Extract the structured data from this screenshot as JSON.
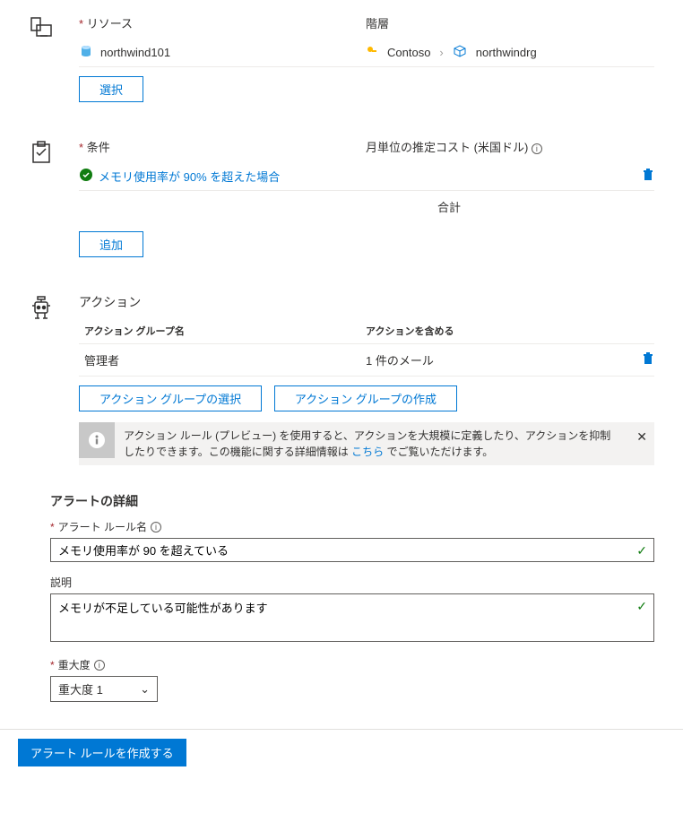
{
  "resource": {
    "label": "リソース",
    "hierarchy_label": "階層",
    "name": "northwind101",
    "subscription": "Contoso",
    "rg": "northwindrg",
    "select_button": "選択"
  },
  "condition": {
    "label": "条件",
    "cost_label": "月単位の推定コスト (米国ドル)",
    "text": "メモリ使用率が 90% を超えた場合",
    "total_label": "合計",
    "add_button": "追加"
  },
  "actions": {
    "heading": "アクション",
    "group_name_header": "アクション グループ名",
    "include_header": "アクションを含める",
    "row": {
      "name": "管理者",
      "include": "1 件のメール"
    },
    "select_group_btn": "アクション グループの選択",
    "create_group_btn": "アクション グループの作成",
    "info_text_1": "アクション ルール (プレビュー) を使用すると、アクションを大規模に定義したり、アクションを抑制したりできます。この機能に関する詳細情報は ",
    "info_link": "こちら",
    "info_text_2": " でご覧いただけます。"
  },
  "details": {
    "heading": "アラートの詳細",
    "rule_name_label": "アラート ルール名",
    "rule_name_value": "メモリ使用率が 90 を超えている",
    "description_label": "説明",
    "description_value": "メモリが不足している可能性があります",
    "severity_label": "重大度",
    "severity_value": "重大度 1"
  },
  "footer": {
    "create_button": "アラート ルールを作成する"
  }
}
